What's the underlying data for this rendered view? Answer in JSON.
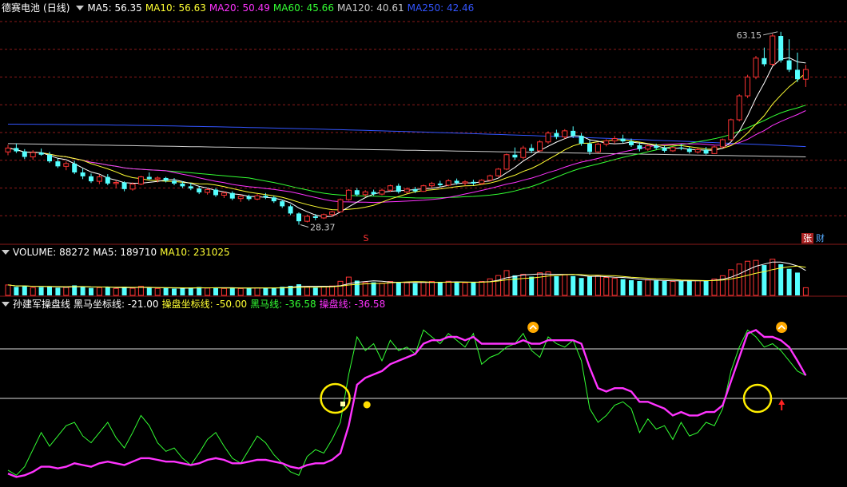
{
  "price_panel": {
    "stock_name": "德赛电池",
    "period": "(日线)",
    "ma_labels": [
      {
        "text": "MA5: 56.35",
        "color": "#ffffff"
      },
      {
        "text": "MA10: 56.63",
        "color": "#ffff33"
      },
      {
        "text": "MA20: 50.49",
        "color": "#ff33ff"
      },
      {
        "text": "MA60: 45.66",
        "color": "#33ff33"
      },
      {
        "text": "MA120: 40.61",
        "color": "#cccccc"
      },
      {
        "text": "MA250: 42.46",
        "color": "#3355ff"
      }
    ],
    "high_label": "63.15",
    "low_label": "28.37",
    "marker_s": "S",
    "badge_zhang": "张",
    "badge_cai": "财"
  },
  "volume_panel": {
    "title": "VOLUME: 88272",
    "ma5": "MA5: 189710",
    "ma10": "MA10: 231025"
  },
  "indicator_panel": {
    "name": "孙建军操盘线",
    "labels": [
      {
        "text": "黑马坐标线: -21.00",
        "color": "#ffffff"
      },
      {
        "text": "操盘坐标线: -50.00",
        "color": "#ffff33"
      },
      {
        "text": "黑马线: -36.58",
        "color": "#33ff33"
      },
      {
        "text": "操盘线: -36.58",
        "color": "#ff33ff"
      }
    ]
  },
  "colors": {
    "up": "#ff3333",
    "down": "#55ffff",
    "ma5": "#ffffff",
    "ma10": "#ffff33",
    "ma20": "#ff33ff",
    "ma60": "#33ff33",
    "ma120": "#cccccc",
    "ma250": "#3355ff",
    "grid": "#8b1a1a"
  },
  "chart_data": {
    "type": "candlestick",
    "price": {
      "ohlc": [
        [
          41.5,
          42.8,
          40.9,
          42.2
        ],
        [
          42.2,
          43.0,
          41.3,
          41.6
        ],
        [
          41.6,
          42.0,
          40.2,
          40.6
        ],
        [
          40.6,
          41.8,
          40.1,
          41.4
        ],
        [
          41.4,
          42.1,
          40.8,
          41.0
        ],
        [
          41.0,
          41.5,
          39.5,
          39.8
        ],
        [
          39.8,
          40.3,
          38.6,
          38.9
        ],
        [
          38.9,
          39.8,
          38.2,
          39.4
        ],
        [
          39.4,
          39.9,
          37.5,
          37.8
        ],
        [
          37.8,
          38.5,
          36.6,
          37.1
        ],
        [
          37.1,
          37.6,
          35.9,
          36.2
        ],
        [
          36.2,
          37.4,
          35.7,
          37.0
        ],
        [
          37.0,
          37.5,
          35.5,
          35.8
        ],
        [
          35.8,
          36.4,
          35.0,
          36.0
        ],
        [
          36.0,
          36.2,
          34.4,
          34.8
        ],
        [
          34.8,
          36.0,
          34.5,
          35.7
        ],
        [
          35.7,
          37.2,
          35.5,
          37.0
        ],
        [
          37.0,
          37.8,
          36.4,
          36.6
        ],
        [
          36.6,
          37.1,
          36.0,
          36.8
        ],
        [
          36.8,
          37.0,
          36.0,
          36.3
        ],
        [
          36.3,
          36.8,
          35.5,
          35.8
        ],
        [
          35.8,
          36.2,
          35.0,
          35.3
        ],
        [
          35.3,
          35.9,
          34.6,
          34.9
        ],
        [
          34.9,
          35.3,
          33.9,
          34.2
        ],
        [
          34.2,
          35.0,
          33.8,
          34.7
        ],
        [
          34.7,
          35.0,
          33.4,
          33.7
        ],
        [
          33.7,
          34.4,
          33.2,
          34.1
        ],
        [
          34.1,
          34.4,
          32.8,
          33.1
        ],
        [
          33.1,
          33.8,
          32.5,
          33.5
        ],
        [
          33.5,
          33.8,
          32.7,
          33.0
        ],
        [
          33.0,
          33.9,
          32.8,
          33.6
        ],
        [
          33.6,
          34.1,
          33.0,
          33.3
        ],
        [
          33.3,
          33.6,
          32.3,
          32.6
        ],
        [
          32.6,
          32.9,
          31.4,
          31.7
        ],
        [
          31.7,
          32.0,
          30.1,
          30.4
        ],
        [
          30.4,
          30.6,
          28.37,
          29.0
        ],
        [
          29.0,
          30.2,
          28.8,
          29.9
        ],
        [
          29.9,
          30.3,
          29.2,
          29.6
        ],
        [
          29.6,
          30.4,
          29.4,
          30.2
        ],
        [
          30.2,
          30.9,
          29.8,
          30.7
        ],
        [
          30.7,
          33.1,
          30.6,
          32.9
        ],
        [
          32.9,
          34.8,
          32.7,
          34.6
        ],
        [
          34.6,
          35.0,
          33.5,
          33.8
        ],
        [
          33.8,
          34.6,
          33.4,
          34.3
        ],
        [
          34.3,
          34.7,
          33.6,
          33.9
        ],
        [
          33.9,
          34.9,
          33.7,
          34.6
        ],
        [
          34.6,
          35.6,
          34.3,
          35.4
        ],
        [
          35.4,
          35.8,
          34.0,
          34.3
        ],
        [
          34.3,
          35.1,
          34.0,
          34.8
        ],
        [
          34.8,
          35.2,
          34.1,
          34.4
        ],
        [
          34.4,
          35.6,
          34.3,
          35.4
        ],
        [
          35.4,
          36.1,
          35.0,
          35.8
        ],
        [
          35.8,
          36.3,
          35.2,
          35.5
        ],
        [
          35.5,
          36.6,
          35.3,
          36.3
        ],
        [
          36.3,
          36.7,
          35.6,
          35.9
        ],
        [
          35.9,
          36.4,
          35.4,
          36.1
        ],
        [
          36.1,
          36.5,
          35.5,
          35.8
        ],
        [
          35.8,
          36.6,
          35.6,
          36.4
        ],
        [
          36.4,
          37.4,
          36.2,
          37.2
        ],
        [
          37.2,
          38.6,
          37.0,
          38.4
        ],
        [
          38.4,
          41.2,
          38.2,
          41.0
        ],
        [
          41.0,
          42.3,
          40.1,
          40.5
        ],
        [
          40.5,
          42.6,
          40.2,
          42.2
        ],
        [
          42.2,
          42.9,
          41.3,
          41.7
        ],
        [
          41.7,
          43.6,
          41.5,
          43.3
        ],
        [
          43.3,
          45.2,
          43.0,
          44.9
        ],
        [
          44.9,
          45.5,
          43.8,
          44.2
        ],
        [
          44.2,
          45.6,
          43.9,
          45.3
        ],
        [
          45.3,
          46.1,
          44.0,
          44.4
        ],
        [
          44.4,
          44.9,
          42.6,
          43.0
        ],
        [
          43.0,
          43.6,
          41.0,
          41.5
        ],
        [
          41.5,
          43.2,
          41.3,
          42.9
        ],
        [
          42.9,
          43.8,
          42.5,
          43.5
        ],
        [
          43.5,
          44.4,
          43.0,
          43.9
        ],
        [
          43.9,
          44.6,
          43.1,
          43.4
        ],
        [
          43.4,
          43.9,
          42.4,
          42.7
        ],
        [
          42.7,
          43.2,
          41.6,
          42.0
        ],
        [
          42.0,
          42.9,
          41.7,
          42.6
        ],
        [
          42.6,
          43.0,
          41.9,
          42.2
        ],
        [
          42.2,
          42.6,
          41.4,
          41.7
        ],
        [
          41.7,
          42.5,
          41.5,
          42.3
        ],
        [
          42.3,
          42.9,
          41.8,
          42.1
        ],
        [
          42.1,
          42.4,
          41.2,
          41.5
        ],
        [
          41.5,
          42.2,
          41.2,
          41.9
        ],
        [
          41.9,
          42.4,
          41.0,
          41.2
        ],
        [
          41.2,
          42.6,
          41.1,
          42.4
        ],
        [
          42.4,
          43.9,
          42.2,
          43.7
        ],
        [
          43.7,
          47.5,
          43.5,
          47.3
        ],
        [
          47.3,
          51.9,
          47.0,
          51.6
        ],
        [
          51.6,
          55.4,
          51.2,
          55.0
        ],
        [
          55.0,
          58.8,
          54.6,
          58.4
        ],
        [
          58.4,
          60.3,
          56.9,
          57.3
        ],
        [
          57.3,
          62.8,
          57.0,
          62.4
        ],
        [
          62.4,
          63.15,
          57.6,
          58.0
        ],
        [
          58.0,
          61.8,
          55.9,
          56.3
        ],
        [
          56.3,
          59.4,
          54.1,
          54.6
        ],
        [
          54.6,
          57.2,
          53.2,
          56.35
        ]
      ],
      "ylim": [
        26,
        66
      ],
      "high": 63.15,
      "low": 28.37
    },
    "volume": {
      "values": [
        120000,
        98000,
        110000,
        90000,
        95000,
        105000,
        88000,
        92000,
        115000,
        100000,
        85000,
        90000,
        96000,
        80000,
        99000,
        82000,
        104000,
        86000,
        80000,
        85000,
        78000,
        82000,
        90000,
        96000,
        84000,
        88000,
        80000,
        92000,
        79000,
        84000,
        86000,
        83000,
        88000,
        99000,
        110000,
        128000,
        96000,
        90000,
        100000,
        108000,
        162000,
        210000,
        170000,
        148000,
        150000,
        140000,
        160000,
        152000,
        145000,
        140000,
        150000,
        160000,
        155000,
        162000,
        150000,
        145000,
        148000,
        160000,
        190000,
        228000,
        285000,
        230000,
        242000,
        215000,
        260000,
        270000,
        220000,
        236000,
        222000,
        200000,
        215000,
        228000,
        206000,
        196000,
        186000,
        175000,
        165000,
        176000,
        172000,
        165000,
        160000,
        168000,
        176000,
        170000,
        165000,
        188000,
        226000,
        295000,
        360000,
        392000,
        402000,
        348000,
        416000,
        358000,
        305000,
        262000,
        88272
      ],
      "ylim": [
        0,
        440000
      ]
    },
    "indicator": {
      "black_horse_line": [
        -92,
        -95,
        -90,
        -80,
        -70,
        -78,
        -72,
        -66,
        -64,
        -72,
        -76,
        -70,
        -64,
        -73,
        -79,
        -70,
        -60,
        -66,
        -76,
        -81,
        -79,
        -85,
        -89,
        -82,
        -74,
        -70,
        -78,
        -85,
        -88,
        -80,
        -72,
        -76,
        -83,
        -88,
        -93,
        -95,
        -84,
        -80,
        -82,
        -74,
        -64,
        -36,
        -14,
        -22,
        -18,
        -28,
        -16,
        -22,
        -20,
        -24,
        -10,
        -14,
        -18,
        -12,
        -16,
        -20,
        -12,
        -30,
        -26,
        -24,
        -20,
        -18,
        -12,
        -22,
        -26,
        -14,
        -18,
        -20,
        -16,
        -28,
        -56,
        -64,
        -60,
        -54,
        -52,
        -56,
        -70,
        -62,
        -68,
        -66,
        -74,
        -64,
        -72,
        -70,
        -64,
        -66,
        -56,
        -34,
        -20,
        -10,
        -14,
        -20,
        -18,
        -22,
        -28,
        -34,
        -36.58
      ],
      "operator_line": [
        -94,
        -96,
        -95,
        -93,
        -90,
        -90,
        -91,
        -90,
        -88,
        -89,
        -90,
        -88,
        -87,
        -88,
        -89,
        -87,
        -85,
        -85,
        -86,
        -87,
        -87,
        -88,
        -89,
        -88,
        -86,
        -85,
        -86,
        -88,
        -88,
        -87,
        -86,
        -86,
        -87,
        -88,
        -90,
        -91,
        -89,
        -88,
        -88,
        -86,
        -82,
        -66,
        -42,
        -38,
        -36,
        -34,
        -30,
        -28,
        -26,
        -24,
        -18,
        -16,
        -16,
        -14,
        -14,
        -16,
        -14,
        -18,
        -18,
        -18,
        -18,
        -18,
        -16,
        -18,
        -18,
        -16,
        -16,
        -16,
        -16,
        -18,
        -32,
        -44,
        -46,
        -44,
        -44,
        -46,
        -52,
        -52,
        -54,
        -56,
        -60,
        -58,
        -60,
        -60,
        -58,
        -58,
        -54,
        -40,
        -26,
        -12,
        -10,
        -14,
        -14,
        -16,
        -20,
        -28,
        -36.58
      ],
      "reference_lines": [
        -21.0,
        -50.0
      ],
      "ylim": [
        -100,
        0
      ]
    }
  }
}
